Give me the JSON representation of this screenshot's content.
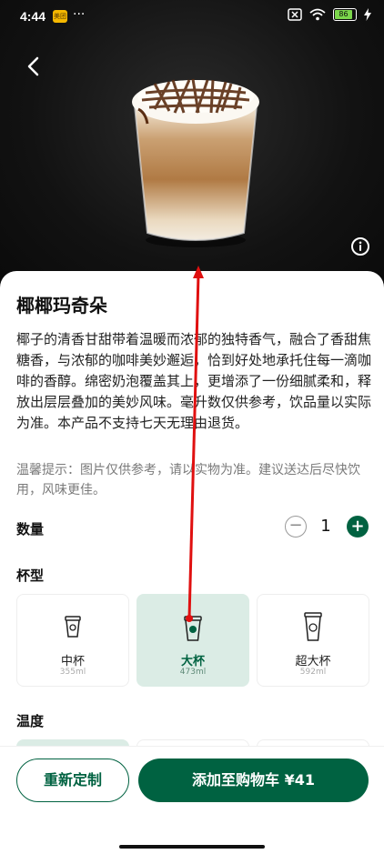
{
  "status_bar": {
    "time": "4:44",
    "app_badge": "美团",
    "more": "···",
    "battery": "86"
  },
  "product": {
    "name": "椰椰玛奇朵",
    "description": "椰子的清香甘甜带着温暖而浓郁的独特香气，融合了香甜焦糖香，与浓郁的咖啡美妙邂逅，恰到好处地承托住每一滴咖啡的香醇。绵密奶泡覆盖其上，更增添了一份细腻柔和，释放出层层叠加的美妙风味。毫升数仅供参考，饮品量以实际为准。本产品不支持七天无理由退货。",
    "tip": "温馨提示：图片仅供参考，请以实物为准。建议送达后尽快饮用，风味更佳。"
  },
  "quantity": {
    "label": "数量",
    "minus": "−",
    "value": "1",
    "plus": "+"
  },
  "cup": {
    "label": "杯型",
    "options": [
      {
        "name": "中杯",
        "volume": "355ml",
        "selected": false
      },
      {
        "name": "大杯",
        "volume": "473ml",
        "selected": true
      },
      {
        "name": "超大杯",
        "volume": "592ml",
        "selected": false
      }
    ]
  },
  "temperature": {
    "label": "温度"
  },
  "actions": {
    "reset_label": "重新定制",
    "add_label": "添加至购物车 ¥41"
  },
  "colors": {
    "brand_green": "#006241",
    "selected_bg": "#dbece5",
    "annotation_arrow": "#e01010"
  }
}
